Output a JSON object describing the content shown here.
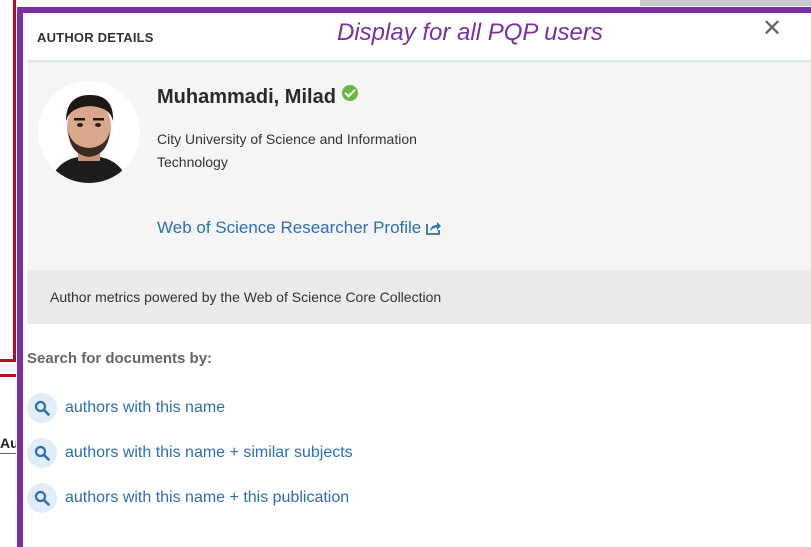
{
  "background": {
    "fragment_text": "Autho"
  },
  "modal": {
    "header": {
      "title": "AUTHOR DETAILS",
      "note": "Display for all PQP users",
      "close_glyph": "✕"
    },
    "author": {
      "name": "Muhammadi, Milad",
      "affiliation_line1": "City University of Science and Information",
      "affiliation_line2": "Technology",
      "verified_icon": "verified-check-icon",
      "profile_link": "Web of Science Researcher Profile",
      "profile_link_icon": "external-link-icon"
    },
    "metrics": {
      "text": "Author metrics powered by the Web of Science Core Collection"
    },
    "search": {
      "heading": "Search for documents by:",
      "items": [
        {
          "label": "authors with this name",
          "icon": "search-icon"
        },
        {
          "label": "authors with this name + similar subjects",
          "icon": "search-icon"
        },
        {
          "label": "authors with this name + this publication",
          "icon": "search-icon"
        }
      ]
    }
  },
  "colors": {
    "modal_border": "#7b2fa3",
    "accent_link": "#2e6fb2",
    "verified": "#6bb642",
    "background_border": "#b0121b"
  }
}
